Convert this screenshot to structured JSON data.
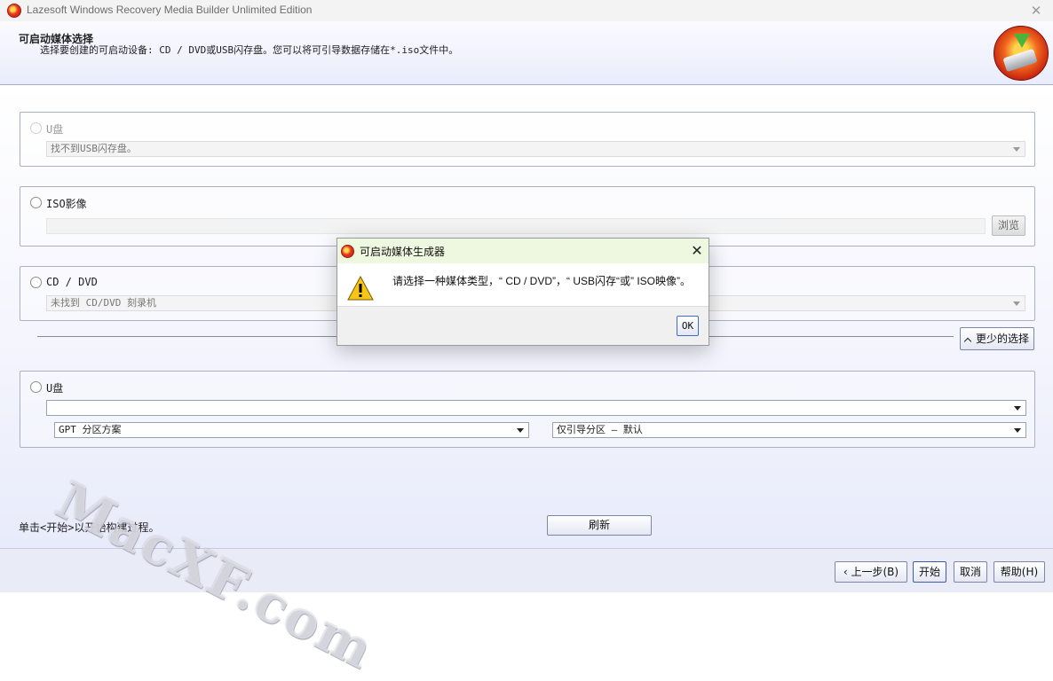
{
  "window": {
    "title": "Lazesoft Windows Recovery Media Builder Unlimited Edition",
    "close_glyph": "✕"
  },
  "header": {
    "title": "可启动媒体选择",
    "subtitle": "选择要创建的可启动设备: CD / DVD或USB闪存盘。您可以将可引导数据存储在*.iso文件中。"
  },
  "options": {
    "usb_top": {
      "label": "U盘",
      "device_value": "找不到USB闪存盘。"
    },
    "iso": {
      "label": "ISO影像",
      "path_value": "",
      "browse_label": "浏览"
    },
    "cd_dvd": {
      "label": "CD / DVD",
      "device_value": "未找到 CD/DVD 刻录机"
    },
    "less_options_label": "更少的选择",
    "usb_bottom": {
      "label": "U盘",
      "device_value": "",
      "partition_scheme": "GPT 分区方案",
      "partition_mode": "仅引导分区 — 默认"
    }
  },
  "status_text": "单击<开始>以开始构建过程。",
  "refresh_label": "刷新",
  "footer": {
    "back_label": "上一步(B)",
    "start_label": "开始",
    "cancel_label": "取消",
    "help_label": "帮助(H)"
  },
  "dialog": {
    "title": "可启动媒体生成器",
    "message": "请选择一种媒体类型，“ CD / DVD”，“ USB闪存“或” ISO映像”。",
    "ok_label": "OK",
    "close_glyph": "✕"
  },
  "watermark": "MacXF.com",
  "colors": {
    "dialog_title_bg": "#eef7e0",
    "header_bg": "#e9ecfb",
    "warning": "#f5c518"
  }
}
